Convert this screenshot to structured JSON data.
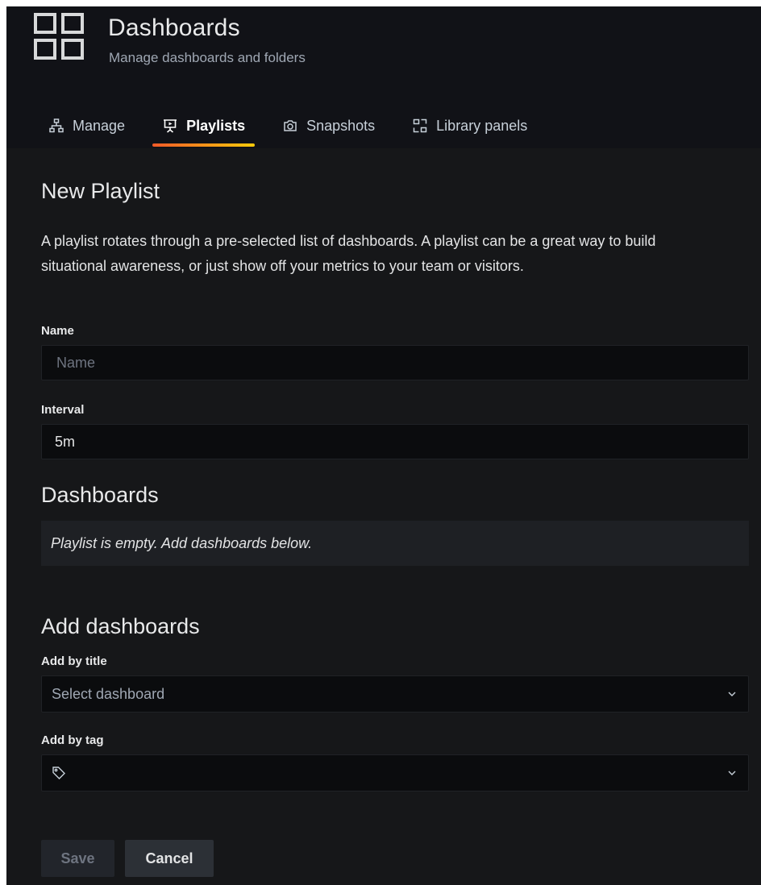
{
  "header": {
    "title": "Dashboards",
    "subtitle": "Manage dashboards and folders",
    "icon": "apps-grid-icon"
  },
  "tabs": [
    {
      "label": "Manage",
      "icon": "sitemap-icon",
      "active": false
    },
    {
      "label": "Playlists",
      "icon": "presentation-play-icon",
      "active": true
    },
    {
      "label": "Snapshots",
      "icon": "camera-icon",
      "active": false
    },
    {
      "label": "Library panels",
      "icon": "library-panel-icon",
      "active": false
    }
  ],
  "form": {
    "heading": "New Playlist",
    "description": "A playlist rotates through a pre-selected list of dashboards. A playlist can be a great way to build situational awareness, or just show off your metrics to your team or visitors.",
    "name_label": "Name",
    "name_placeholder": "Name",
    "name_value": "",
    "interval_label": "Interval",
    "interval_value": "5m"
  },
  "dashboards": {
    "heading": "Dashboards",
    "empty_message": "Playlist is empty. Add dashboards below."
  },
  "add_dashboards": {
    "heading": "Add dashboards",
    "by_title_label": "Add by title",
    "by_title_placeholder": "Select dashboard",
    "by_tag_label": "Add by tag",
    "by_tag_placeholder": ""
  },
  "actions": {
    "save_label": "Save",
    "cancel_label": "Cancel"
  },
  "colors": {
    "background": "#161719",
    "header_background": "#111217",
    "input_background": "#0b0c0e",
    "active_tab_gradient_start": "#f05a28",
    "active_tab_gradient_end": "#fbca0a"
  }
}
